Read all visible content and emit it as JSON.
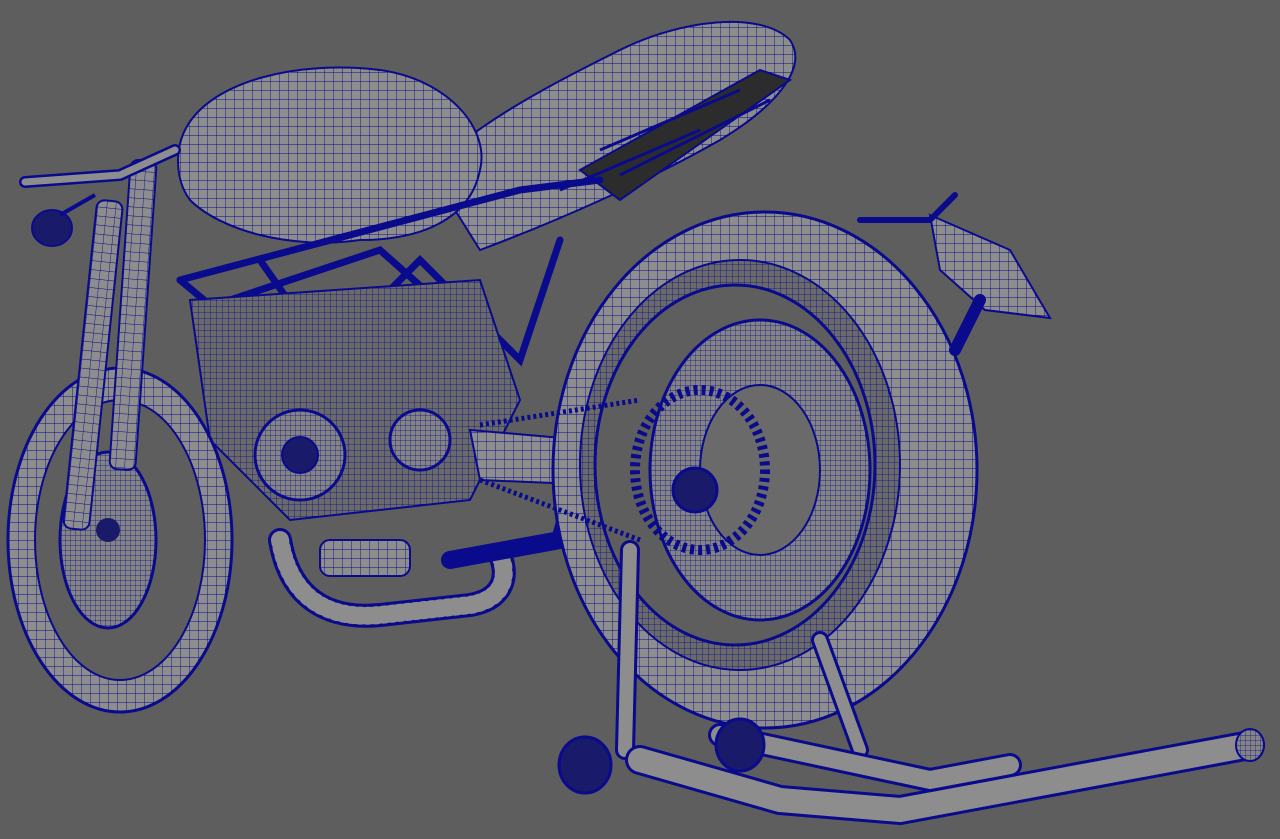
{
  "viewport": {
    "background_color": "#5e5e5e",
    "wire_color": "#0a0a8c",
    "surface_color": "#8d8d8d",
    "surface_dark": "#6e6e6e",
    "display_mode": "wireframe-on-shaded"
  },
  "scene": {
    "model": "motorcycle",
    "parts": [
      "front-wheel",
      "front-fork",
      "handlebar",
      "mirror",
      "fuel-tank",
      "seat-tail",
      "frame-trellis",
      "engine",
      "exhaust-pipe",
      "rear-wheel",
      "rear-brake-disc",
      "swingarm",
      "chain-sprocket",
      "license-plate-bracket",
      "paddock-stand"
    ]
  }
}
